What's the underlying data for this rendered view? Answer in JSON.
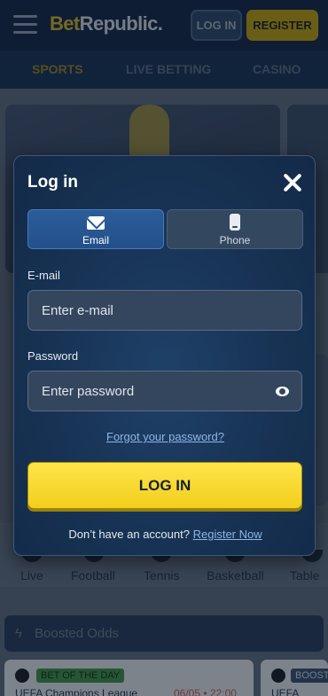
{
  "header": {
    "logo_bet": "Bet",
    "logo_rest": "Republic.",
    "login_label": "LOG IN",
    "register_label": "REGISTER"
  },
  "nav": {
    "sports": "SPORTS",
    "live_betting": "LIVE BETTING",
    "casino": "CASINO"
  },
  "sports_row": [
    "Live",
    "Football",
    "Tennis",
    "Basketball",
    "Table"
  ],
  "boosted": {
    "label": "Boosted Odds"
  },
  "cards": [
    {
      "badge": "BET OF THE DAY",
      "league": "UEFA Champions League",
      "time": "06/05 • 22:00"
    },
    {
      "badge": "BOOST",
      "league": "UEFA Cham"
    }
  ],
  "modal": {
    "title": "Log in",
    "tabs": {
      "email": "Email",
      "phone": "Phone"
    },
    "email": {
      "label": "E-mail",
      "placeholder": "Enter e-mail"
    },
    "password": {
      "label": "Password",
      "placeholder": "Enter password"
    },
    "forgot": "Forgot your password?",
    "submit": "LOG IN",
    "footer_text": "Don’t have an account?",
    "footer_link": "Register Now"
  },
  "colors": {
    "accent_yellow": "#f2cf1c",
    "tab_active": "#23508a",
    "link": "#8fb4e6"
  }
}
